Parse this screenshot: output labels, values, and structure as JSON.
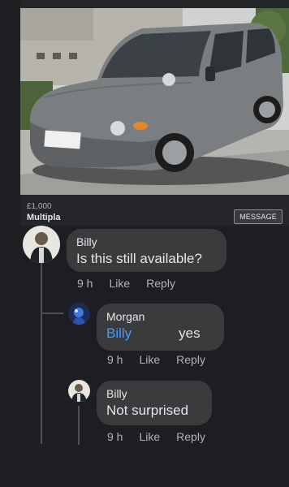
{
  "listing": {
    "price": "£1,000",
    "title": "Multipla",
    "message_label": "MESSAGE"
  },
  "comments": [
    {
      "author": "Billy",
      "text": "Is this still available?",
      "time": "9 h",
      "like": "Like",
      "reply": "Reply"
    },
    {
      "author": "Morgan",
      "mention": "Billy",
      "text": "yes",
      "time": "9 h",
      "like": "Like",
      "reply": "Reply"
    },
    {
      "author": "Billy",
      "text": "Not surprised",
      "time": "9 h",
      "like": "Like",
      "reply": "Reply"
    }
  ],
  "colors": {
    "background": "#1e1e22",
    "bubble": "#3a3b3c",
    "mention": "#4599ff",
    "meta_text": "#b0b3b8",
    "car_body": "#7b7e80"
  }
}
